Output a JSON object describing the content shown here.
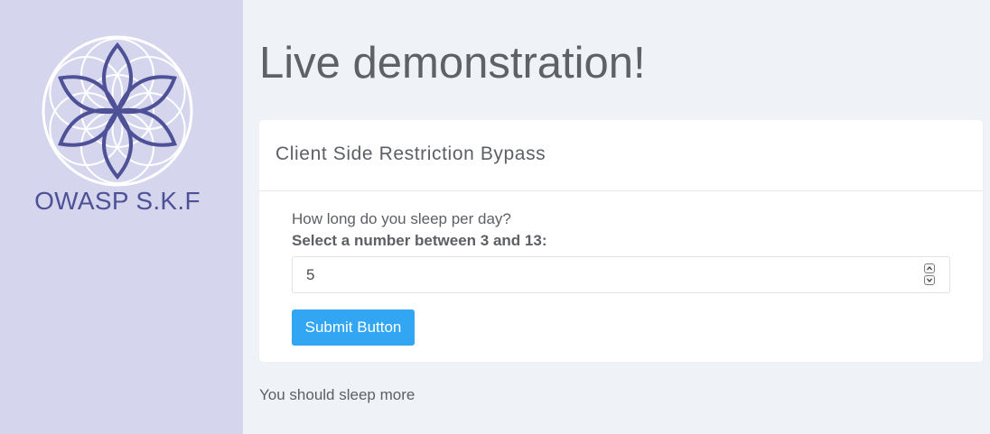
{
  "sidebar": {
    "logo_icon": "flower-of-life-logo-icon",
    "brand_name": "OWASP S.K.F"
  },
  "main": {
    "page_title": "Live demonstration!",
    "card": {
      "title": "Client Side Restriction Bypass",
      "question": "How long do you sleep per day?",
      "field_label": "Select a number between 3 and 13:",
      "input_value": "5",
      "stepper_icons": [
        "chevron-up-icon",
        "chevron-down-icon"
      ],
      "submit_label": "Submit Button"
    },
    "result_message": "You should sleep more"
  },
  "colors": {
    "sidebar_bg": "#d5d6ee",
    "page_bg": "#eff2f6",
    "brand": "#4f5196",
    "button": "#33a6f3"
  }
}
